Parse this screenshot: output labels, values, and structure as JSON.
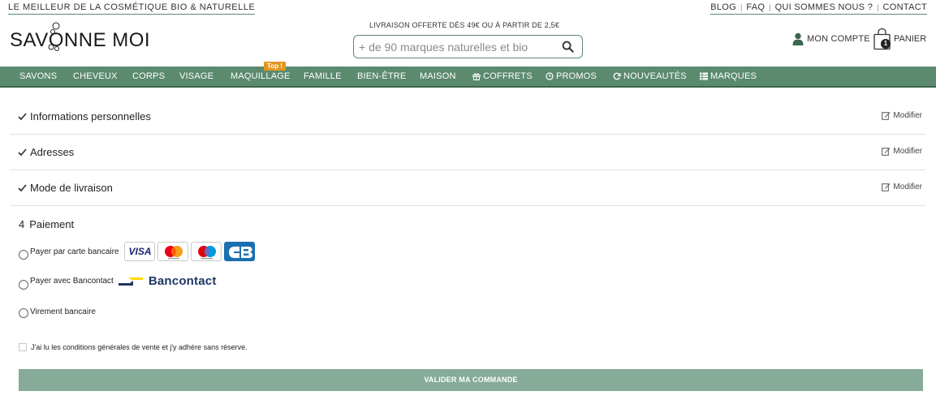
{
  "topbar": {
    "tagline": "LE MEILLEUR DE LA COSMÉTIQUE BIO & NATURELLE",
    "links": [
      "BLOG",
      "FAQ",
      "QUI SOMMES NOUS ?",
      "CONTACT"
    ]
  },
  "header": {
    "logo_text": "SAVONNE MOI",
    "shipping_notice": "LIVRAISON OFFERTE DÈS 49€ OU À PARTIR DE 2,5€",
    "search_placeholder": "+ de 90 marques naturelles et bio",
    "account_label": "MON COMPTE",
    "cart_label": "PANIER",
    "cart_count": "1"
  },
  "nav": {
    "items": [
      "SAVONS",
      "CHEVEUX",
      "CORPS",
      "VISAGE",
      "MAQUILLAGE",
      "FAMILLE",
      "BIEN-ÊTRE",
      "MAISON",
      "COFFRETS",
      "PROMOS",
      "NOUVEAUTÉS",
      "MARQUES"
    ],
    "top_badge": "Top !"
  },
  "checkout": {
    "steps": [
      {
        "title": "Informations personnelles",
        "edit_label": "Modifier"
      },
      {
        "title": "Adresses",
        "edit_label": "Modifier"
      },
      {
        "title": "Mode de livraison",
        "edit_label": "Modifier"
      }
    ],
    "payment": {
      "number": "4",
      "title": "Paiement",
      "options": [
        {
          "label": "Payer par carte bancaire",
          "selected": false
        },
        {
          "label": "Payer avec Bancontact",
          "selected": false
        },
        {
          "label": "Virement bancaire",
          "selected": false
        }
      ],
      "card_brands": [
        "VISA",
        "Mastercard",
        "Maestro",
        "CB"
      ],
      "bancontact_brand": "Bancontact"
    },
    "terms_label": "J'ai lu les conditions générales de vente et j'y adhère sans réserve.",
    "submit_label": "VALIDER MA COMMANDE"
  },
  "colors": {
    "brand_green": "#5b8a6f",
    "button_green": "#86ab98",
    "badge_orange": "#e3961f"
  }
}
